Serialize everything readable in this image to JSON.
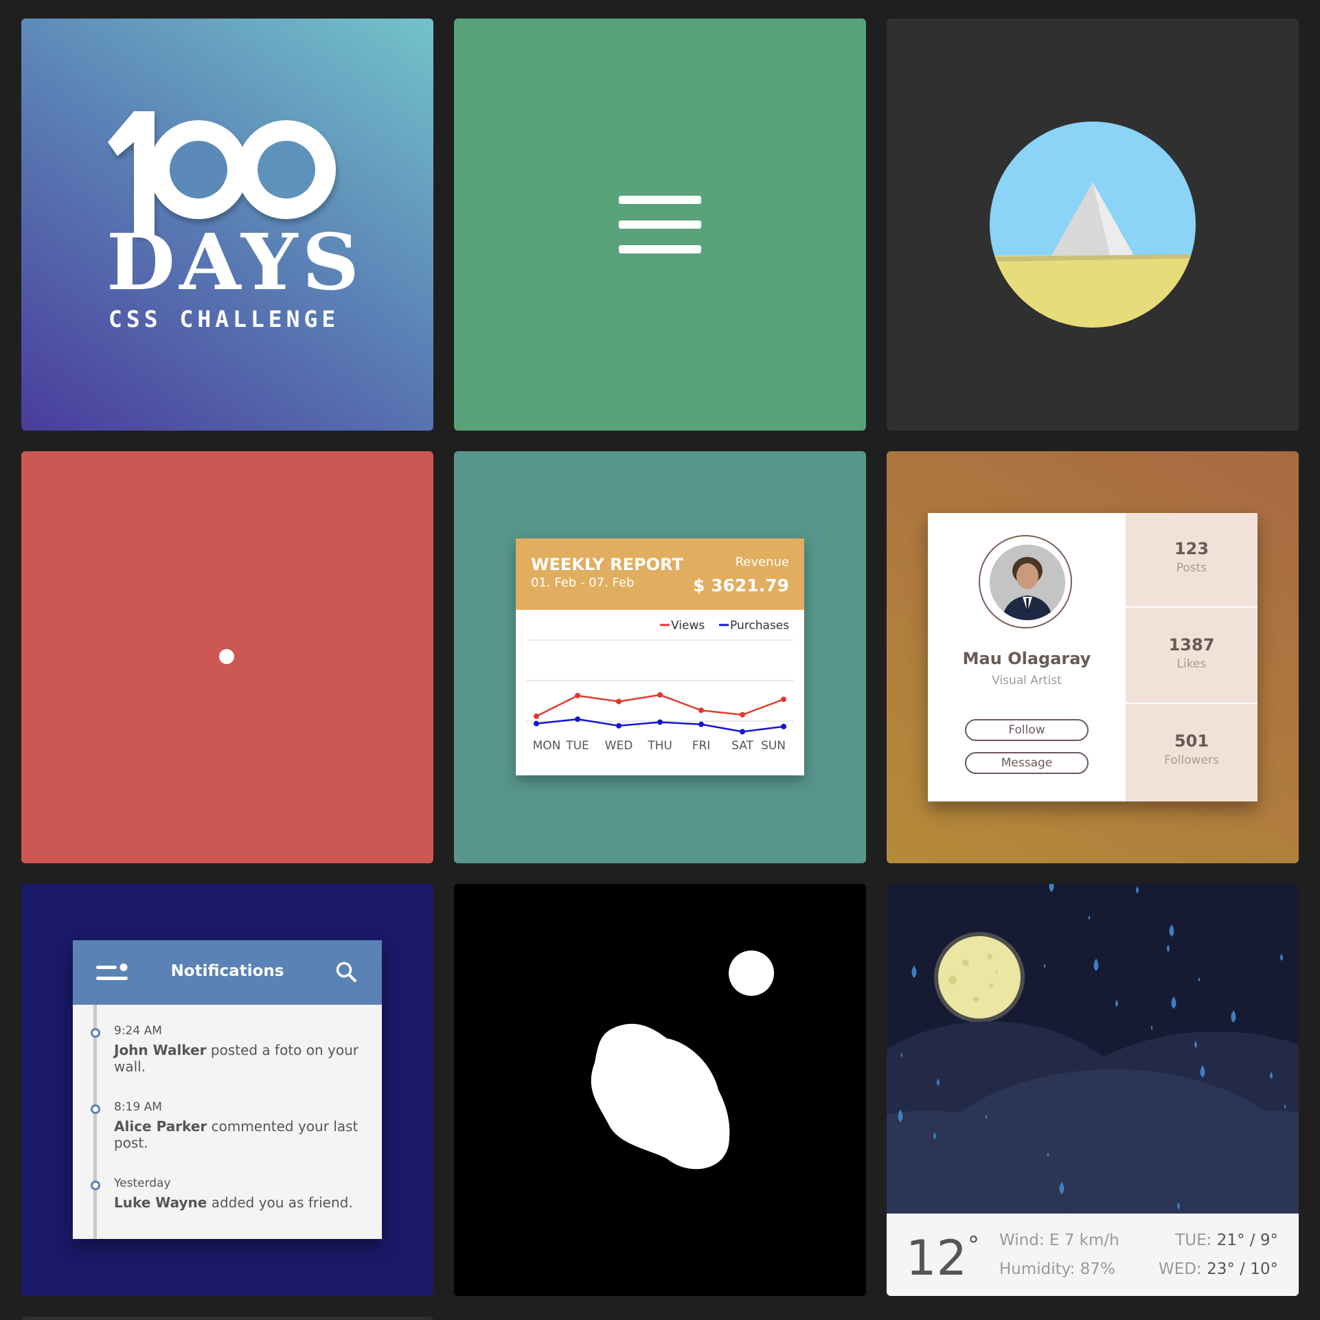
{
  "logo": {
    "number": "100",
    "word": "DAYS",
    "subtitle": "CSS CHALLENGE"
  },
  "icons": {
    "hamburger": "hamburger-menu-icon",
    "pyramid": "pyramid-scene-icon",
    "menu": "menu-icon",
    "search": "search-icon",
    "moon": "moon-icon"
  },
  "colors": {
    "tile_green": "#59a27a",
    "tile_red": "#cd5752",
    "tile_teal": "#57968c",
    "report_header": "#e1ad5e",
    "views_line": "#e03a2f",
    "purchases_line": "#1414d6",
    "notif_header": "#5a82b5",
    "tile_navy": "#1b1a6b"
  },
  "report": {
    "title": "WEEKLY REPORT",
    "date_range": "01. Feb - 07. Feb",
    "revenue_label": "Revenue",
    "revenue_value": "$ 3621.79"
  },
  "chart_data": {
    "type": "line",
    "categories": [
      "MON",
      "TUE",
      "WED",
      "THU",
      "FRI",
      "SAT",
      "SUN"
    ],
    "series": [
      {
        "name": "Views",
        "values": [
          44,
          72,
          64,
          73,
          52,
          46,
          67
        ]
      },
      {
        "name": "Purchases",
        "values": [
          34,
          40,
          31,
          36,
          33,
          23,
          30
        ]
      }
    ],
    "ylim": [
      0,
      100
    ],
    "grid": true,
    "legend": "top-right"
  },
  "profile": {
    "name": "Mau Olagaray",
    "role": "Visual Artist",
    "follow_label": "Follow",
    "message_label": "Message",
    "stats": [
      {
        "value": "123",
        "label": "Posts"
      },
      {
        "value": "1387",
        "label": "Likes"
      },
      {
        "value": "501",
        "label": "Followers"
      }
    ]
  },
  "notifications": {
    "title": "Notifications",
    "items": [
      {
        "time": "9:24 AM",
        "name": "John Walker",
        "text": " posted a foto on your wall."
      },
      {
        "time": "8:19 AM",
        "name": "Alice Parker",
        "text": " commented your last post."
      },
      {
        "time": "Yesterday",
        "name": "Luke Wayne",
        "text": " added you as friend."
      }
    ]
  },
  "weather": {
    "temp": "12",
    "degree": "°",
    "wind_label": "Wind: E 7 km/h",
    "humidity_label": "Humidity: 87%",
    "forecast": [
      {
        "day": "TUE:",
        "value": "21° / 9°"
      },
      {
        "day": "WED:",
        "value": "23° / 10°"
      }
    ]
  }
}
